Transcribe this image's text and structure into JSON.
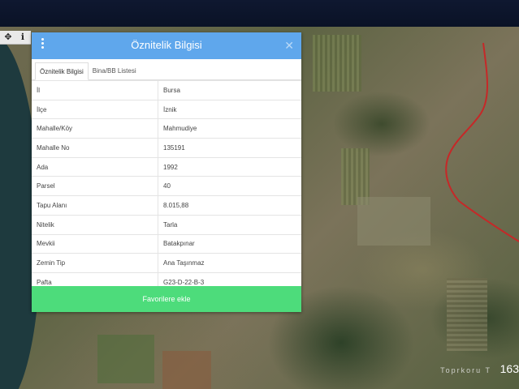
{
  "panel": {
    "title": "Öznitelik Bilgisi",
    "tabs": [
      "Öznitelik Bilgisi",
      "Bina/BB Listesi"
    ],
    "rows": [
      {
        "label": "İl",
        "value": "Bursa"
      },
      {
        "label": "İlçe",
        "value": "İznik"
      },
      {
        "label": "Mahalle/Köy",
        "value": "Mahmudiye"
      },
      {
        "label": "Mahalle No",
        "value": "135191"
      },
      {
        "label": "Ada",
        "value": "1992"
      },
      {
        "label": "Parsel",
        "value": "40"
      },
      {
        "label": "Tapu Alanı",
        "value": "8.015,88"
      },
      {
        "label": "Nitelik",
        "value": "Tarla"
      },
      {
        "label": "Mevkii",
        "value": "Batakpınar"
      },
      {
        "label": "Zemin Tip",
        "value": "Ana Taşınmaz"
      },
      {
        "label": "Pafta",
        "value": "G23-D-22-B-3"
      }
    ],
    "favorite_button": "Favorilere ekle"
  },
  "map": {
    "overlay_text": "Toprkoru T",
    "overlay_number": "163"
  },
  "colors": {
    "header": "#5fa7ec",
    "button": "#4ddc7b",
    "parcel_boundary": "#c62828"
  }
}
